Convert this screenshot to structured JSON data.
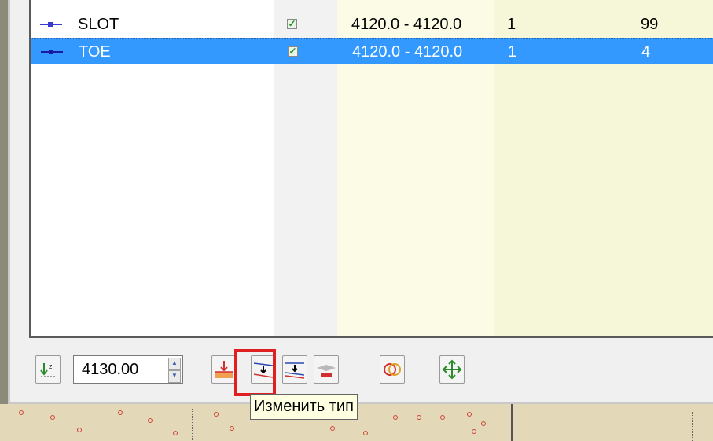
{
  "layers": {
    "rows": [
      {
        "name": "SLOT",
        "visible": true,
        "range": "4120.0 - 4120.0",
        "count": "1",
        "value": "99",
        "selected": false
      },
      {
        "name": "TOE",
        "visible": true,
        "range": "4120.0 - 4120.0",
        "count": "1",
        "value": "4",
        "selected": true
      }
    ]
  },
  "toolbar": {
    "elevation_value": "4130.00",
    "buttons": [
      {
        "name": "sort-z-button",
        "icon": "sort-z-icon"
      },
      {
        "name": "add-layer-button",
        "icon": "add-layer-icon"
      },
      {
        "name": "change-type-button",
        "icon": "change-type-icon"
      },
      {
        "name": "split-layer-button",
        "icon": "split-layer-icon"
      },
      {
        "name": "remove-layer-button",
        "icon": "remove-layer-icon"
      },
      {
        "name": "intersect-button",
        "icon": "intersect-icon"
      },
      {
        "name": "move-button",
        "icon": "move-icon"
      }
    ]
  },
  "tooltip": {
    "text": "Изменить тип"
  },
  "colors": {
    "selection": "#3399ff",
    "highlight": "#e02020",
    "tooltip_bg": "#ffffe1",
    "column_tint": "#f8f8dc"
  }
}
